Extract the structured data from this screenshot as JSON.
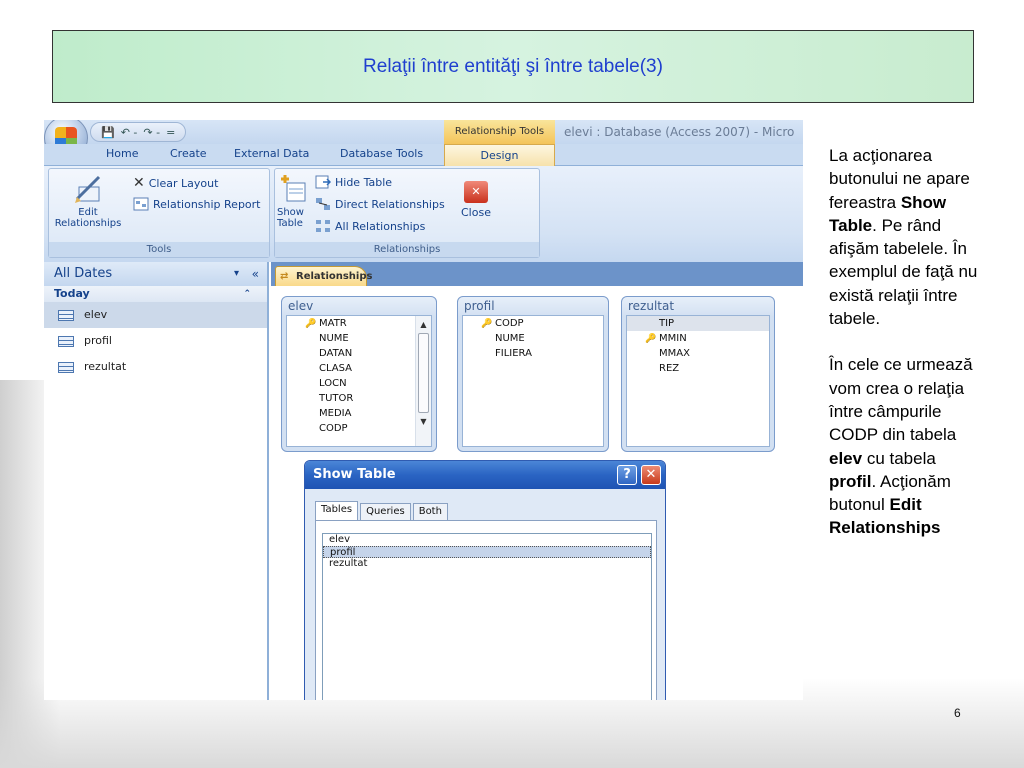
{
  "slide": {
    "title": "Relaţii între entităţi şi între tabele(3)",
    "page_number": "6"
  },
  "access": {
    "quick_access": [
      "💾",
      "↶ -",
      "↷ -",
      "="
    ],
    "context_tab": "Relationship Tools",
    "window_title": "elevi : Database (Access 2007) - Micro",
    "tabs": [
      "Home",
      "Create",
      "External Data",
      "Database Tools"
    ],
    "active_tab": "Design",
    "ribbon": {
      "tools_group": {
        "label": "Tools",
        "edit_relationships": "Edit\nRelationships",
        "clear_layout": "Clear Layout",
        "relationship_report": "Relationship Report"
      },
      "relationships_group": {
        "label": "Relationships",
        "show_table": "Show\nTable",
        "hide_table": "Hide Table",
        "direct_relationships": "Direct Relationships",
        "all_relationships": "All Relationships",
        "close": "Close"
      }
    },
    "nav_pane": {
      "header": "All Dates",
      "group": "Today",
      "items": [
        "elev",
        "profil",
        "rezultat"
      ],
      "selected": "elev"
    },
    "doc_tab": "Relationships",
    "tables": [
      {
        "name": "elev",
        "fields": [
          "MATR",
          "NUME",
          "DATAN",
          "CLASA",
          "LOCN",
          "TUTOR",
          "MEDIA",
          "CODP"
        ],
        "key": "MATR"
      },
      {
        "name": "profil",
        "fields": [
          "CODP",
          "NUME",
          "FILIERA"
        ],
        "key": "CODP"
      },
      {
        "name": "rezultat",
        "fields": [
          "TIP",
          "MMIN",
          "MMAX",
          "REZ"
        ],
        "key": "MMIN",
        "selected": "TIP"
      }
    ],
    "show_table": {
      "title": "Show Table",
      "help": "?",
      "close": "✕",
      "tabs": [
        "Tables",
        "Queries",
        "Both"
      ],
      "active_tab": "Tables",
      "items": [
        "elev",
        "profil",
        "rezultat"
      ],
      "selected": "profil"
    }
  },
  "side_text": {
    "p1_a": "La acţionarea butonului ne apare fereastra ",
    "p1_b": "Show Table",
    "p1_c": ". Pe rând afişăm tabelele. În exemplul de faţă nu există relaţii între tabele.",
    "p2_a": "În cele ce urmează vom crea o relaţia între câmpurile CODP din tabela ",
    "p2_b": "elev",
    "p2_c": " cu tabela ",
    "p2_d": "profil",
    "p2_e": ". Acţionăm butonul ",
    "p2_f": "Edit Relationships"
  }
}
